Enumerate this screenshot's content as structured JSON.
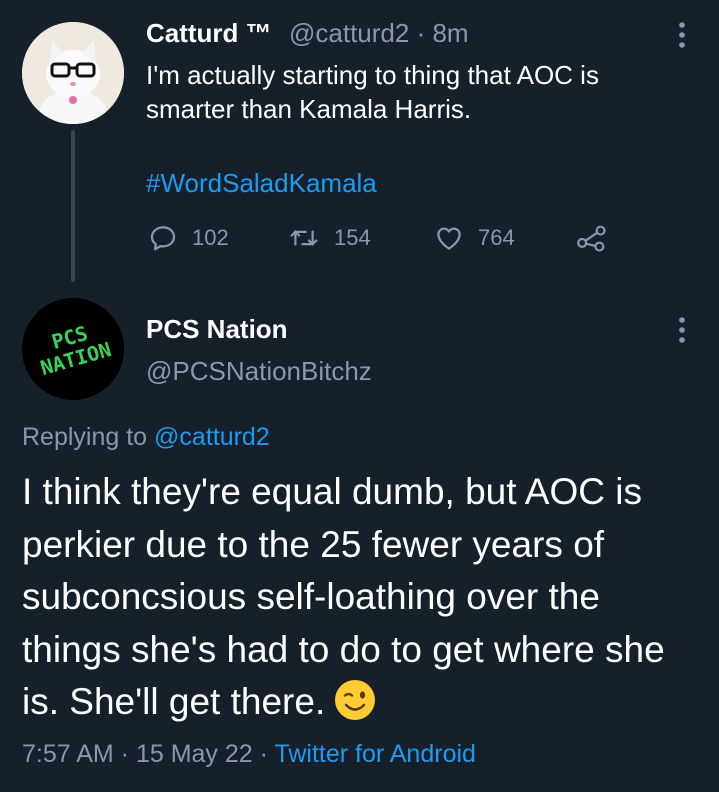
{
  "parent_tweet": {
    "display_name": "Catturd ™",
    "handle_time": "@catturd2 · 8m",
    "text": "I'm actually starting to thing that AOC is smarter than Kamala Harris.",
    "hashtag": "#WordSaladKamala",
    "replies": "102",
    "retweets": "154",
    "likes": "764"
  },
  "reply_tweet": {
    "display_name": "PCS Nation",
    "handle": "@PCSNationBitchz",
    "avatar_text_line1": "PCS",
    "avatar_text_line2": "NATION",
    "replying_prefix": "Replying to ",
    "replying_to": "@catturd2",
    "text": "I think they're equal dumb, but AOC is perkier due to the 25 fewer years of subconcsious self-loathing over the things she's had to do to get where she is. She'll get there.",
    "timestamp": "7:57 AM · 15 May 22 · ",
    "source": "Twitter for Android"
  },
  "colors": {
    "background": "#15202b",
    "accent": "#1d9bf0",
    "secondary_text": "#8b98a5",
    "avatar_text_green": "#39d353"
  },
  "icons": {
    "reply": "reply-icon",
    "retweet": "retweet-icon",
    "like": "heart-icon",
    "share": "share-icon",
    "more": "more-vertical-icon",
    "emoji": "winking-face-icon"
  }
}
